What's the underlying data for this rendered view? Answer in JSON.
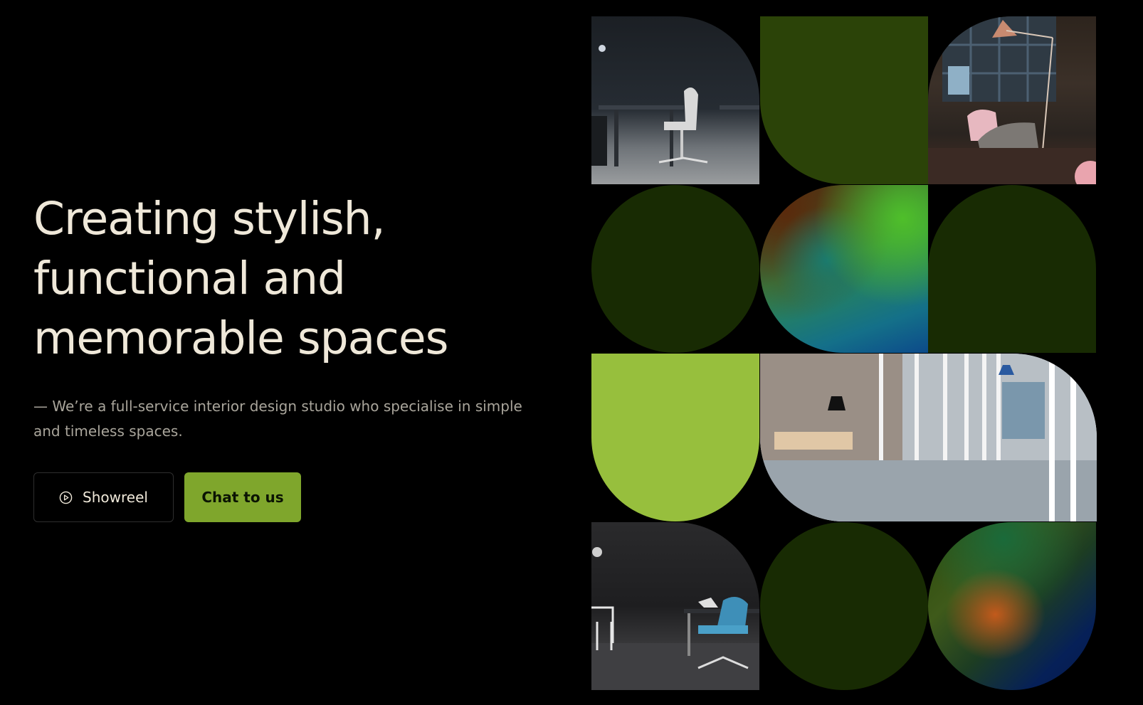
{
  "hero": {
    "headline_line1": "Creating stylish,",
    "headline_line2": "functional and",
    "headline_line3": "memorable spaces",
    "tagline": "— We’re a full-service interior design studio who specialise in simple and timeless spaces."
  },
  "actions": {
    "showreel_label": "Showreel",
    "showreel_icon": "play-circle-icon",
    "chat_label": "Chat to us"
  },
  "colors": {
    "background": "#000000",
    "headline": "#efe8d9",
    "tagline": "#a9a59b",
    "accent": "#7fa62c",
    "dark_green": "#2b4308",
    "deep_green": "#182b03",
    "lime": "#97bf3d"
  },
  "mosaic": {
    "tiles": [
      {
        "name": "office-desk-photo",
        "kind": "photo"
      },
      {
        "name": "dark-green-quarter",
        "kind": "color"
      },
      {
        "name": "lounge-lamp-photo",
        "kind": "photo"
      },
      {
        "name": "deep-green-circle",
        "kind": "color"
      },
      {
        "name": "gradient-green-teal",
        "kind": "gradient"
      },
      {
        "name": "deep-green-quarter",
        "kind": "color"
      },
      {
        "name": "lime-arch",
        "kind": "color"
      },
      {
        "name": "glass-corridor-photo",
        "kind": "photo"
      },
      {
        "name": "blue-chair-desk-photo",
        "kind": "photo"
      },
      {
        "name": "deep-green-circle-2",
        "kind": "color"
      },
      {
        "name": "gradient-orange-blue",
        "kind": "gradient"
      }
    ]
  }
}
